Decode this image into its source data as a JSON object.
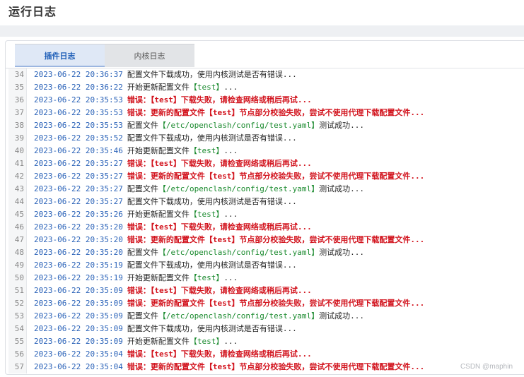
{
  "page": {
    "title": "运行日志"
  },
  "tabs": [
    {
      "label": "插件日志",
      "active": true
    },
    {
      "label": "内核日志",
      "active": false
    }
  ],
  "log_lines": [
    {
      "num": "34",
      "time": "2023-06-22 20:36:37",
      "msg": "配置文件下载成功，使用内核测试是否有错误...",
      "level": "info"
    },
    {
      "num": "35",
      "time": "2023-06-22 20:36:22",
      "msg": "开始更新配置文件【test】...",
      "level": "info"
    },
    {
      "num": "36",
      "time": "2023-06-22 20:35:53",
      "msg": "错误：【test】下载失败，请检查网络或稍后再试...",
      "level": "error"
    },
    {
      "num": "37",
      "time": "2023-06-22 20:35:53",
      "msg": "错误：更新的配置文件【test】节点部分校验失败，尝试不使用代理下载配置文件...",
      "level": "error"
    },
    {
      "num": "38",
      "time": "2023-06-22 20:35:53",
      "msg": "配置文件【/etc/openclash/config/test.yaml】测试成功...",
      "level": "info"
    },
    {
      "num": "39",
      "time": "2023-06-22 20:35:52",
      "msg": "配置文件下载成功，使用内核测试是否有错误...",
      "level": "info"
    },
    {
      "num": "40",
      "time": "2023-06-22 20:35:46",
      "msg": "开始更新配置文件【test】...",
      "level": "info"
    },
    {
      "num": "41",
      "time": "2023-06-22 20:35:27",
      "msg": "错误：【test】下载失败，请检查网络或稍后再试...",
      "level": "error"
    },
    {
      "num": "42",
      "time": "2023-06-22 20:35:27",
      "msg": "错误：更新的配置文件【test】节点部分校验失败，尝试不使用代理下载配置文件...",
      "level": "error"
    },
    {
      "num": "43",
      "time": "2023-06-22 20:35:27",
      "msg": "配置文件【/etc/openclash/config/test.yaml】测试成功...",
      "level": "info"
    },
    {
      "num": "44",
      "time": "2023-06-22 20:35:27",
      "msg": "配置文件下载成功，使用内核测试是否有错误...",
      "level": "info"
    },
    {
      "num": "45",
      "time": "2023-06-22 20:35:26",
      "msg": "开始更新配置文件【test】...",
      "level": "info"
    },
    {
      "num": "46",
      "time": "2023-06-22 20:35:20",
      "msg": "错误：【test】下载失败，请检查网络或稍后再试...",
      "level": "error"
    },
    {
      "num": "47",
      "time": "2023-06-22 20:35:20",
      "msg": "错误：更新的配置文件【test】节点部分校验失败，尝试不使用代理下载配置文件...",
      "level": "error"
    },
    {
      "num": "48",
      "time": "2023-06-22 20:35:20",
      "msg": "配置文件【/etc/openclash/config/test.yaml】测试成功...",
      "level": "info"
    },
    {
      "num": "49",
      "time": "2023-06-22 20:35:19",
      "msg": "配置文件下载成功，使用内核测试是否有错误...",
      "level": "info"
    },
    {
      "num": "50",
      "time": "2023-06-22 20:35:19",
      "msg": "开始更新配置文件【test】...",
      "level": "info"
    },
    {
      "num": "51",
      "time": "2023-06-22 20:35:09",
      "msg": "错误：【test】下载失败，请检查网络或稍后再试...",
      "level": "error"
    },
    {
      "num": "52",
      "time": "2023-06-22 20:35:09",
      "msg": "错误：更新的配置文件【test】节点部分校验失败，尝试不使用代理下载配置文件...",
      "level": "error"
    },
    {
      "num": "53",
      "time": "2023-06-22 20:35:09",
      "msg": "配置文件【/etc/openclash/config/test.yaml】测试成功...",
      "level": "info"
    },
    {
      "num": "54",
      "time": "2023-06-22 20:35:09",
      "msg": "配置文件下载成功，使用内核测试是否有错误...",
      "level": "info"
    },
    {
      "num": "55",
      "time": "2023-06-22 20:35:09",
      "msg": "开始更新配置文件【test】...",
      "level": "info"
    },
    {
      "num": "56",
      "time": "2023-06-22 20:35:04",
      "msg": "错误：【test】下载失败，请检查网络或稍后再试...",
      "level": "error"
    },
    {
      "num": "57",
      "time": "2023-06-22 20:35:04",
      "msg": "错误：更新的配置文件【test】节点部分校验失败，尝试不使用代理下载配置文件...",
      "level": "error"
    }
  ],
  "watermark": "CSDN @maphin",
  "colors": {
    "timestamp": "#2a62b8",
    "error": "#d2141e",
    "highlight": "#1a8a2e"
  }
}
